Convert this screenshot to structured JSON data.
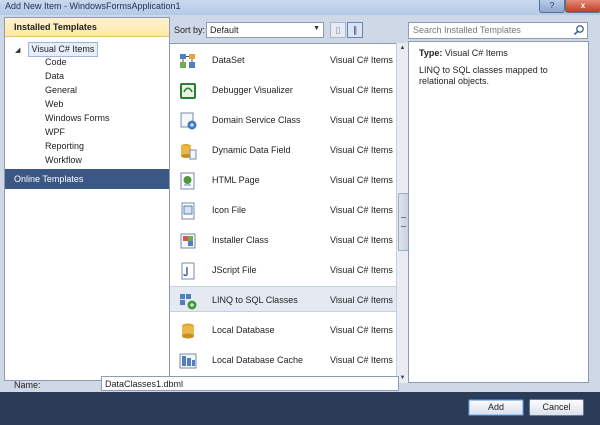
{
  "window": {
    "title": "Add New Item - WindowsFormsApplication1",
    "help_glyph": "?",
    "close_glyph": "x"
  },
  "left_pane": {
    "header": "Installed Templates",
    "root": {
      "label": "Visual C# Items",
      "expander": "◢"
    },
    "children": [
      "Code",
      "Data",
      "General",
      "Web",
      "Windows Forms",
      "WPF",
      "Reporting",
      "Workflow"
    ],
    "online": "Online Templates"
  },
  "toolbar": {
    "sort_label": "Sort by:",
    "sort_value": "Default",
    "dropdown_arrow": "▼",
    "small_icons_glyph": "▯",
    "large_icons_glyph": "∥"
  },
  "templates": [
    {
      "name": "DataSet",
      "category": "Visual C# Items",
      "icon": "dataset-icon",
      "selected": false
    },
    {
      "name": "Debugger Visualizer",
      "category": "Visual C# Items",
      "icon": "debugger-visualizer-icon",
      "selected": false
    },
    {
      "name": "Domain Service Class",
      "category": "Visual C# Items",
      "icon": "domain-service-icon",
      "selected": false
    },
    {
      "name": "Dynamic Data Field",
      "category": "Visual C# Items",
      "icon": "dynamic-data-field-icon",
      "selected": false
    },
    {
      "name": "HTML Page",
      "category": "Visual C# Items",
      "icon": "html-page-icon",
      "selected": false
    },
    {
      "name": "Icon File",
      "category": "Visual C# Items",
      "icon": "icon-file-icon",
      "selected": false
    },
    {
      "name": "Installer Class",
      "category": "Visual C# Items",
      "icon": "installer-class-icon",
      "selected": false
    },
    {
      "name": "JScript File",
      "category": "Visual C# Items",
      "icon": "jscript-file-icon",
      "selected": false
    },
    {
      "name": "LINQ to SQL Classes",
      "category": "Visual C# Items",
      "icon": "linq-to-sql-icon",
      "selected": true
    },
    {
      "name": "Local Database",
      "category": "Visual C# Items",
      "icon": "local-database-icon",
      "selected": false
    },
    {
      "name": "Local Database Cache",
      "category": "Visual C# Items",
      "icon": "local-database-cache-icon",
      "selected": false
    }
  ],
  "scrollbar": {
    "up_glyph": "▲",
    "down_glyph": "▼"
  },
  "search": {
    "placeholder": "Search Installed Templates"
  },
  "details": {
    "type_label": "Type:",
    "type_value": "Visual C# Items",
    "description": "LINQ to SQL classes mapped to relational objects."
  },
  "name_field": {
    "label": "Name:",
    "value": "DataClasses1.dbml"
  },
  "buttons": {
    "add": "Add",
    "cancel": "Cancel"
  },
  "colors": {
    "frame": "#2b3c59",
    "selection": "#e5eaf2",
    "online_highlight": "#3b5786",
    "header_yellow": "#fde8a6"
  }
}
